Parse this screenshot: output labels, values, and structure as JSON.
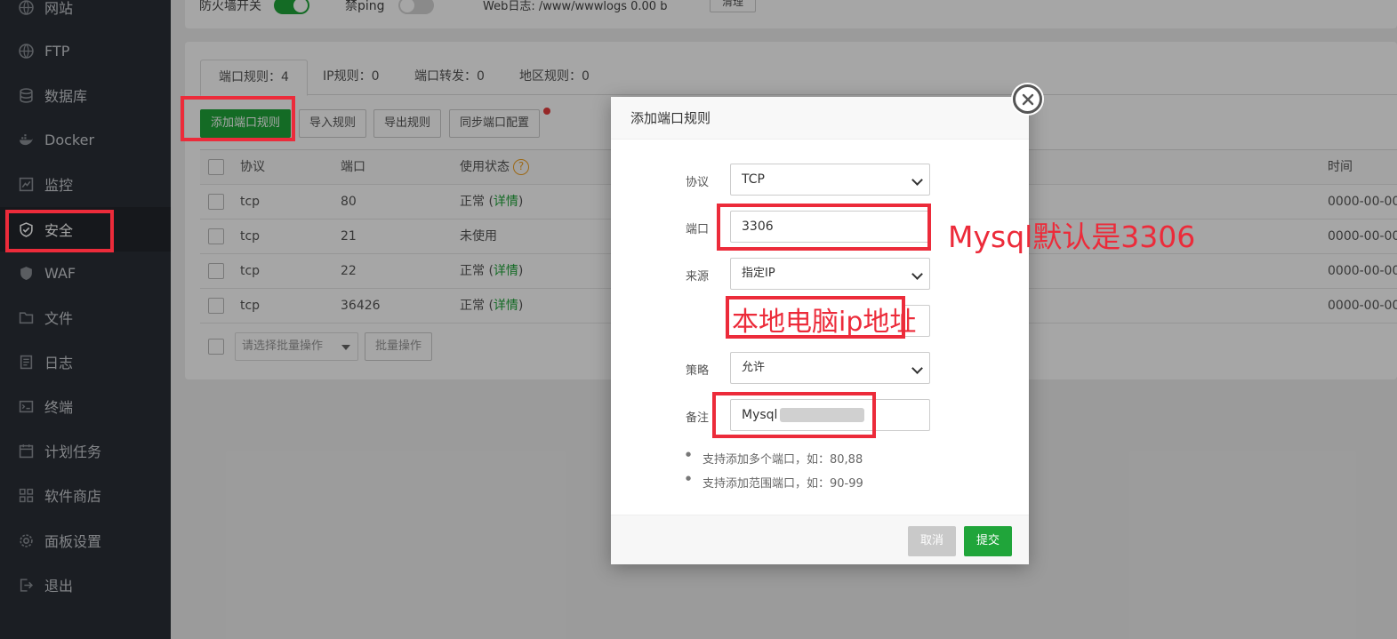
{
  "sidebar": {
    "items": [
      {
        "label": "网站",
        "icon": "globe-icon"
      },
      {
        "label": "FTP",
        "icon": "globe-icon"
      },
      {
        "label": "数据库",
        "icon": "database-icon"
      },
      {
        "label": "Docker",
        "icon": "docker-icon"
      },
      {
        "label": "监控",
        "icon": "monitor-icon"
      },
      {
        "label": "安全",
        "icon": "shield-icon",
        "active": true
      },
      {
        "label": "WAF",
        "icon": "waf-shield-icon"
      },
      {
        "label": "文件",
        "icon": "folder-icon"
      },
      {
        "label": "日志",
        "icon": "log-icon"
      },
      {
        "label": "终端",
        "icon": "terminal-icon"
      },
      {
        "label": "计划任务",
        "icon": "calendar-icon"
      },
      {
        "label": "软件商店",
        "icon": "apps-icon"
      },
      {
        "label": "面板设置",
        "icon": "gear-icon"
      },
      {
        "label": "退出",
        "icon": "logout-icon"
      }
    ]
  },
  "topbar": {
    "firewall_label": "防火墙开关",
    "ping_label": "禁ping",
    "firewall_on": true,
    "ping_on": false,
    "weblog_text": "Web日志: /www/wwwlogs  0.00 b",
    "clear_label": "清理"
  },
  "tabs": [
    {
      "label": "端口规则：4"
    },
    {
      "label": "IP规则：0"
    },
    {
      "label": "端口转发：0"
    },
    {
      "label": "地区规则：0"
    }
  ],
  "toolbar": {
    "add_port_rule": "添加端口规则",
    "import_rules": "导入规则",
    "export_rules": "导出规则",
    "sync_port_config": "同步端口配置"
  },
  "table": {
    "headers": {
      "protocol": "协议",
      "port": "端口",
      "status": "使用状态",
      "time": "时间"
    },
    "rows": [
      {
        "protocol": "tcp",
        "port": "80",
        "status": "正常 (",
        "detail": "详情",
        "close": ")",
        "time": "0000-00-00"
      },
      {
        "protocol": "tcp",
        "port": "21",
        "status": "未使用",
        "detail": "",
        "close": "",
        "time": "0000-00-00"
      },
      {
        "protocol": "tcp",
        "port": "22",
        "status": "正常 (",
        "detail": "详情",
        "close": ")",
        "time": "0000-00-00"
      },
      {
        "protocol": "tcp",
        "port": "36426",
        "status": "正常 (",
        "detail": "详情",
        "close": ")",
        "time": "0000-00-00"
      }
    ],
    "batch_placeholder": "请选择批量操作",
    "batch_button": "批量操作"
  },
  "modal": {
    "title": "添加端口规则",
    "protocol_label": "协议",
    "protocol_value": "TCP",
    "port_label": "端口",
    "port_value": "3306",
    "source_label": "来源",
    "source_value": "指定IP",
    "policy_label": "策略",
    "policy_value": "允许",
    "remark_label": "备注",
    "remark_value": "Mysql",
    "notes": [
      "支持添加多个端口，如：80,88",
      "支持添加范围端口，如：90-99"
    ],
    "cancel_label": "取消",
    "submit_label": "提交"
  },
  "annotations": {
    "port_note": "Mysql默认是3306",
    "ip_note": "本地电脑ip地址",
    "color": "#ec2b3a"
  },
  "colors": {
    "sidebar_bg": "#2a2f37",
    "accent_green": "#20a53a"
  }
}
